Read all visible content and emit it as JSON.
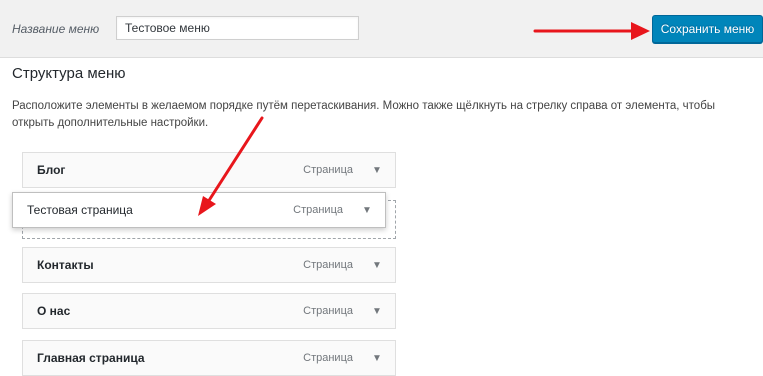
{
  "header": {
    "menu_name_label": "Название меню",
    "menu_name_value": "Тестовое меню",
    "save_label": "Сохранить меню"
  },
  "structure": {
    "title": "Структура меню",
    "instructions": "Расположите элементы в желаемом порядке путём перетаскивания. Можно также щёлкнуть на стрелку справа от элемента, чтобы открыть дополнительные настройки."
  },
  "menu_items": [
    {
      "title": "Блог",
      "type": "Страница"
    },
    {
      "title": "Тестовая страница",
      "type": "Страница",
      "state": "dragging"
    },
    {
      "title": "Контакты",
      "type": "Страница"
    },
    {
      "title": "О нас",
      "type": "Страница"
    },
    {
      "title": "Главная страница",
      "type": "Страница"
    }
  ],
  "colors": {
    "accent": "#0085ba",
    "annotation_arrow": "#e8161c"
  },
  "icons": {
    "toggle": "triangle-down-icon"
  }
}
